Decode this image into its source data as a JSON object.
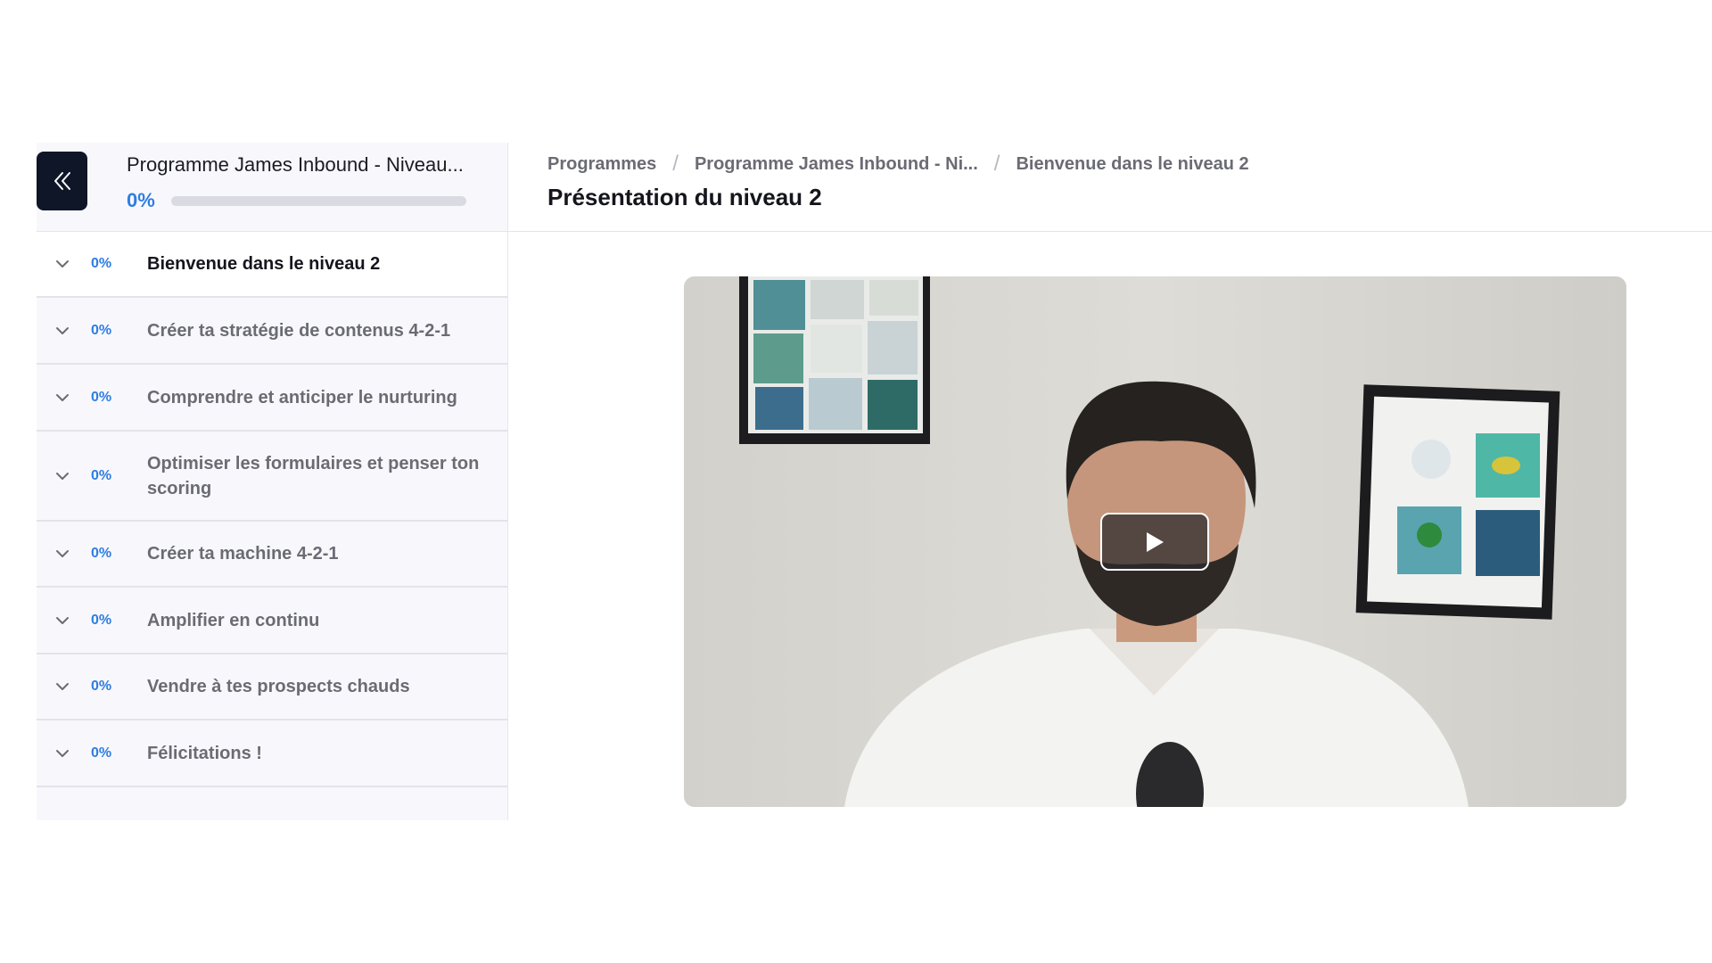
{
  "sidebar": {
    "collapse_label": "Collapse sidebar",
    "program_title": "Programme James Inbound - Niveau...",
    "program_progress_label": "0%",
    "program_progress": 0,
    "chapters": [
      {
        "percent": "0%",
        "title": "Bienvenue dans le niveau 2",
        "active": true
      },
      {
        "percent": "0%",
        "title": "Créer ta stratégie de contenus 4-2-1",
        "active": false
      },
      {
        "percent": "0%",
        "title": "Comprendre et anticiper le nurturing",
        "active": false
      },
      {
        "percent": "0%",
        "title": "Optimiser les formulaires et penser ton scoring",
        "active": false
      },
      {
        "percent": "0%",
        "title": "Créer ta machine 4-2-1",
        "active": false
      },
      {
        "percent": "0%",
        "title": "Amplifier en continu",
        "active": false
      },
      {
        "percent": "0%",
        "title": "Vendre à tes prospects chauds",
        "active": false
      },
      {
        "percent": "0%",
        "title": "Félicitations !",
        "active": false
      }
    ]
  },
  "breadcrumb": {
    "items": [
      "Programmes",
      "Programme James Inbound - Ni...",
      "Bienvenue dans le niveau 2"
    ],
    "separator": "/"
  },
  "main": {
    "page_title": "Présentation du niveau 2"
  },
  "icons": {
    "collapse": "double-chevron-left-icon",
    "chapter_toggle": "chevron-down-icon",
    "play": "play-icon"
  },
  "colors": {
    "accent": "#2f7de1",
    "dark": "#0e1628",
    "muted_text": "#6b6b74"
  }
}
